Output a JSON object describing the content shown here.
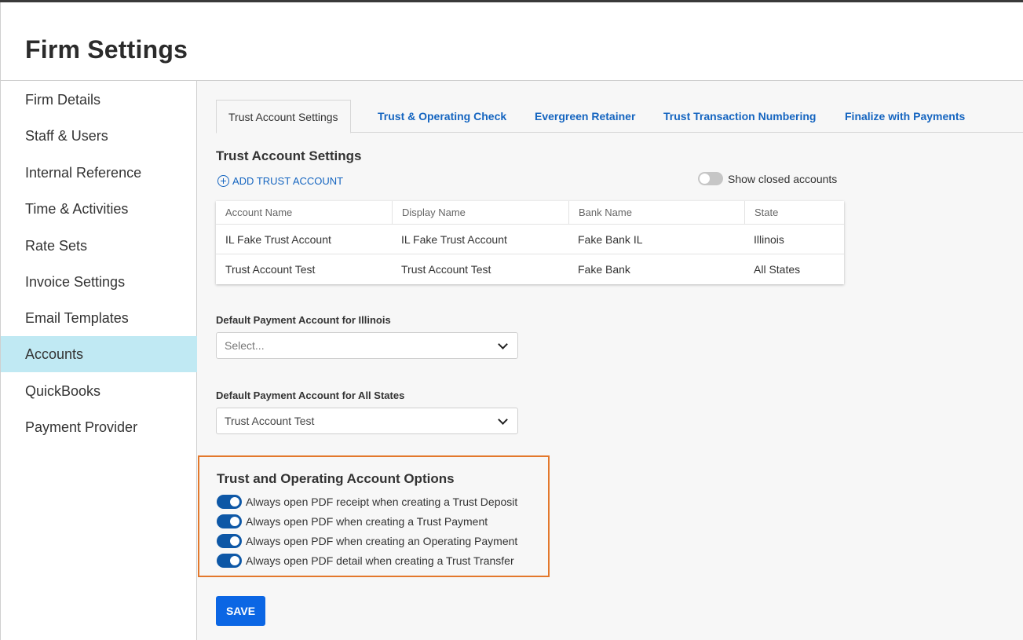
{
  "page": {
    "title": "Firm Settings"
  },
  "sidebar": {
    "items": [
      {
        "label": "Firm Details",
        "active": false
      },
      {
        "label": "Staff & Users",
        "active": false
      },
      {
        "label": "Internal Reference",
        "active": false
      },
      {
        "label": "Time & Activities",
        "active": false
      },
      {
        "label": "Rate Sets",
        "active": false
      },
      {
        "label": "Invoice Settings",
        "active": false
      },
      {
        "label": "Email Templates",
        "active": false
      },
      {
        "label": "Accounts",
        "active": true
      },
      {
        "label": "QuickBooks",
        "active": false
      },
      {
        "label": "Payment Provider",
        "active": false
      }
    ]
  },
  "tabs": [
    {
      "label": "Trust Account Settings",
      "active": true
    },
    {
      "label": "Trust & Operating Check",
      "active": false
    },
    {
      "label": "Evergreen Retainer",
      "active": false
    },
    {
      "label": "Trust Transaction Numbering",
      "active": false
    },
    {
      "label": "Finalize with Payments",
      "active": false
    }
  ],
  "trust_settings": {
    "title": "Trust Account Settings",
    "add_label": "ADD TRUST ACCOUNT",
    "show_closed_label": "Show closed accounts",
    "show_closed_on": false
  },
  "accounts_table": {
    "columns": [
      "Account Name",
      "Display Name",
      "Bank Name",
      "State"
    ],
    "rows": [
      [
        "IL Fake Trust Account",
        "IL Fake Trust Account",
        "Fake Bank IL",
        "Illinois"
      ],
      [
        "Trust Account Test",
        "Trust Account Test",
        "Fake Bank",
        "All States"
      ]
    ]
  },
  "defaults": {
    "illinois": {
      "label": "Default Payment Account for Illinois",
      "placeholder": "Select...",
      "value": ""
    },
    "all_states": {
      "label": "Default Payment Account for All States",
      "value": "Trust Account Test"
    }
  },
  "options": {
    "title": "Trust and Operating Account Options",
    "highlight_color": "#e3782c",
    "items": [
      {
        "label": "Always open PDF receipt when creating a Trust Deposit",
        "on": true
      },
      {
        "label": "Always open PDF when creating a Trust Payment",
        "on": true
      },
      {
        "label": "Always open PDF when creating an Operating Payment",
        "on": true
      },
      {
        "label": "Always open PDF detail when creating a Trust Transfer",
        "on": true
      }
    ]
  },
  "save_label": "SAVE"
}
